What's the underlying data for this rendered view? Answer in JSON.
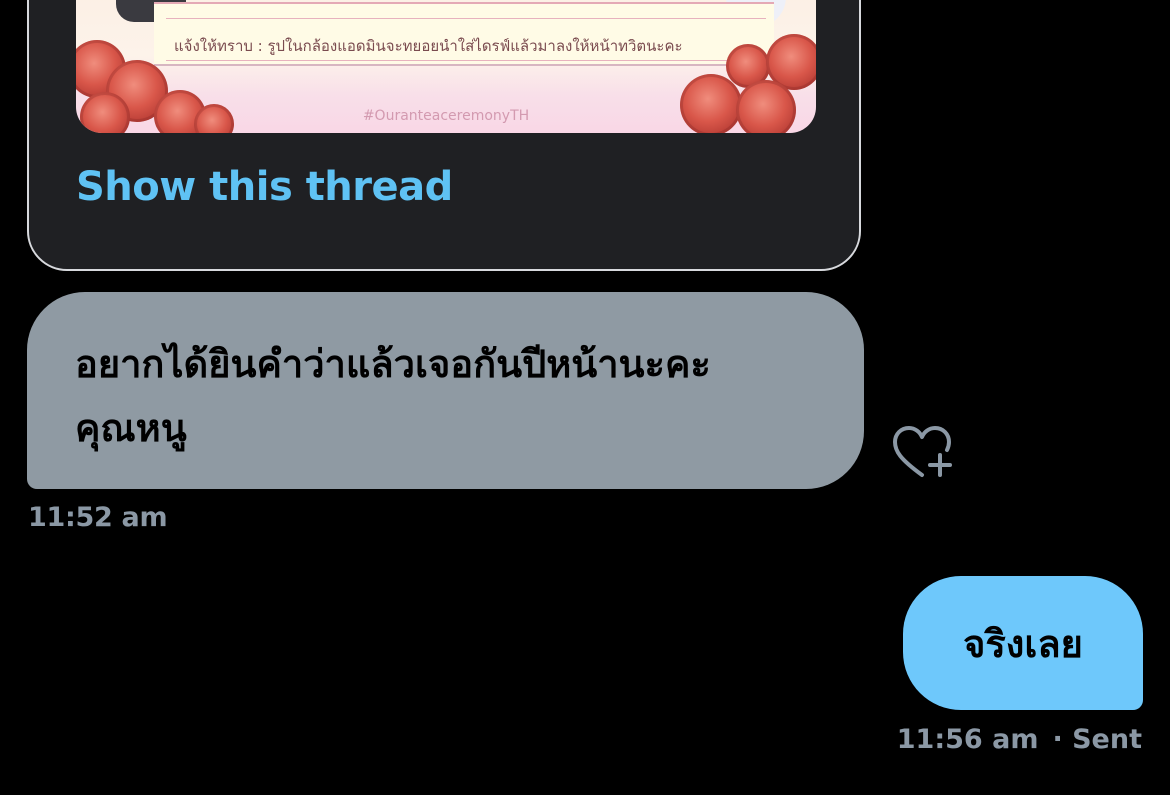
{
  "conversation": {
    "shared_tweet": {
      "image": {
        "notice_text": "แจ้งให้ทราบ : รูปในกล้องแอดมินจะทยอยนำใส่ไดรฟ์แล้วมาลงให้หน้าทวิตนะคะ",
        "hashtag": "#OuranteaceremonyTH"
      },
      "show_thread_label": "Show this thread"
    },
    "received_message": {
      "text": "อยากได้ยินคำว่าแล้วเจอกันปีหน้านะคะคุณหนู",
      "timestamp": "11:52 am",
      "react_icon": "heart-plus-icon"
    },
    "sent_message": {
      "text": "จริงเลย",
      "timestamp": "11:56 am",
      "status": "· Sent"
    }
  },
  "colors": {
    "background": "#000000",
    "card_background": "#1f2023",
    "card_border": "#d7d9dd",
    "link": "#5fc2f4",
    "received_bubble": "#8f9aa3",
    "sent_bubble": "#6ec8fb",
    "meta_text": "#8b98a5"
  }
}
